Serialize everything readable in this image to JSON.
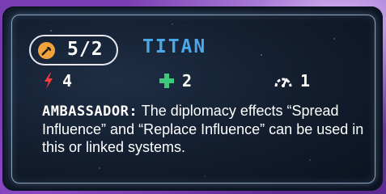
{
  "card": {
    "cost": "5/2",
    "ship_name": "TITAN",
    "stats": {
      "attack": "4",
      "health": "2",
      "speed": "1"
    },
    "ability": {
      "name": "AMBASSADOR:",
      "text": " The diplomacy effects “Spread Influence” and “Replace Influence” can be used in this or linked systems."
    },
    "icons": {
      "cost": "wrench-icon",
      "attack": "lightning-bolt-icon",
      "health": "plus-icon",
      "speed": "speedometer-icon"
    },
    "colors": {
      "cost_icon": "#f2a23a",
      "ship_name": "#4aa8e8",
      "attack": "#ff3b3b",
      "health": "#3ec87a",
      "frame": "#8aa3bf"
    }
  }
}
